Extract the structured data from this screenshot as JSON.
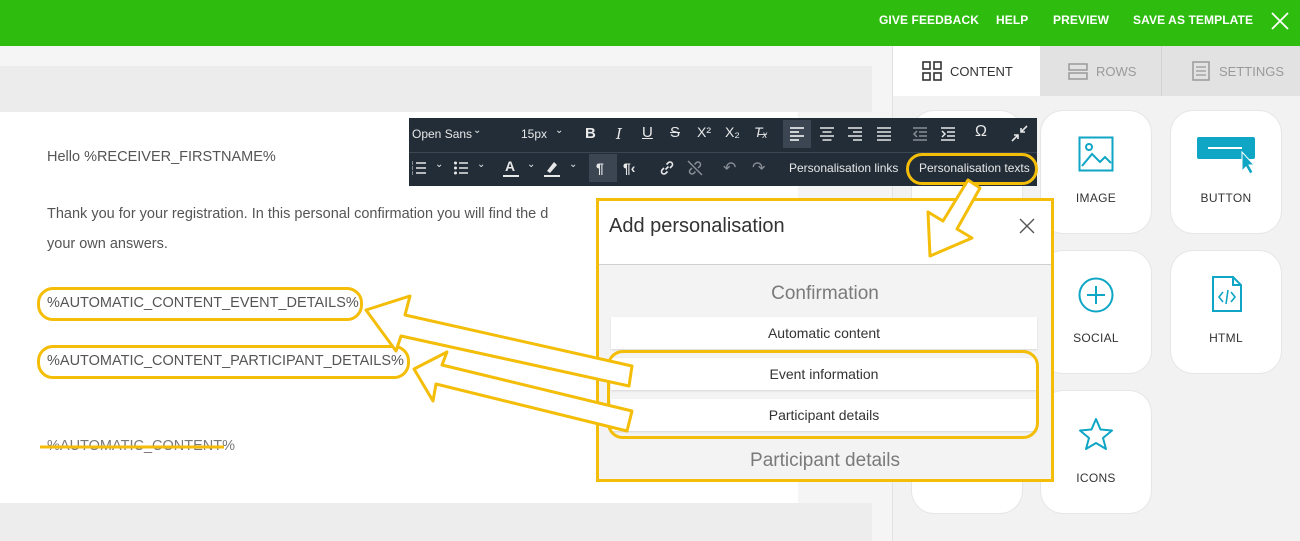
{
  "topbar": {
    "give_feedback": "GIVE FEEDBACK",
    "help": "HELP",
    "preview": "PREVIEW",
    "save_as_template": "SAVE AS TEMPLATE",
    "bg_color": "#2ebd0f"
  },
  "editor": {
    "greeting": "Hello %RECEIVER_FIRSTNAME%",
    "body_line1": "Thank you for your registration. In this personal confirmation you will find the d",
    "body_line2": "your own answers.",
    "placeholder_event": "%AUTOMATIC_CONTENT_EVENT_DETAILS%",
    "placeholder_participant": "%AUTOMATIC_CONTENT_PARTICIPANT_DETAILS%",
    "placeholder_removed": "%AUTOMATIC_CONTENT%"
  },
  "toolbar": {
    "font_family": "Open Sans",
    "font_size": "15px",
    "personalisation_links": "Personalisation links",
    "personalisation_texts": "Personalisation texts"
  },
  "sidebar": {
    "tabs": [
      {
        "label": "CONTENT",
        "icon": "grid-icon",
        "active": true
      },
      {
        "label": "ROWS",
        "icon": "rows-icon",
        "active": false
      },
      {
        "label": "SETTINGS",
        "icon": "settings-doc-icon",
        "active": false
      }
    ],
    "tiles": [
      {
        "label": "IMAGE",
        "icon": "image-icon"
      },
      {
        "label": "BUTTON",
        "icon": "button-icon"
      },
      {
        "label": "SOCIAL",
        "icon": "plus-circle-icon"
      },
      {
        "label": "HTML",
        "icon": "html-icon"
      },
      {
        "label": "ICONS",
        "icon": "star-icon"
      }
    ]
  },
  "dialog": {
    "title": "Add personalisation",
    "section1": "Confirmation",
    "items": [
      "Automatic content",
      "Event information",
      "Participant details"
    ],
    "section2": "Participant details"
  },
  "colors": {
    "accent_teal": "#0fa5c5",
    "highlight": "#f4bd08",
    "toolbar_bg": "#222d38"
  }
}
